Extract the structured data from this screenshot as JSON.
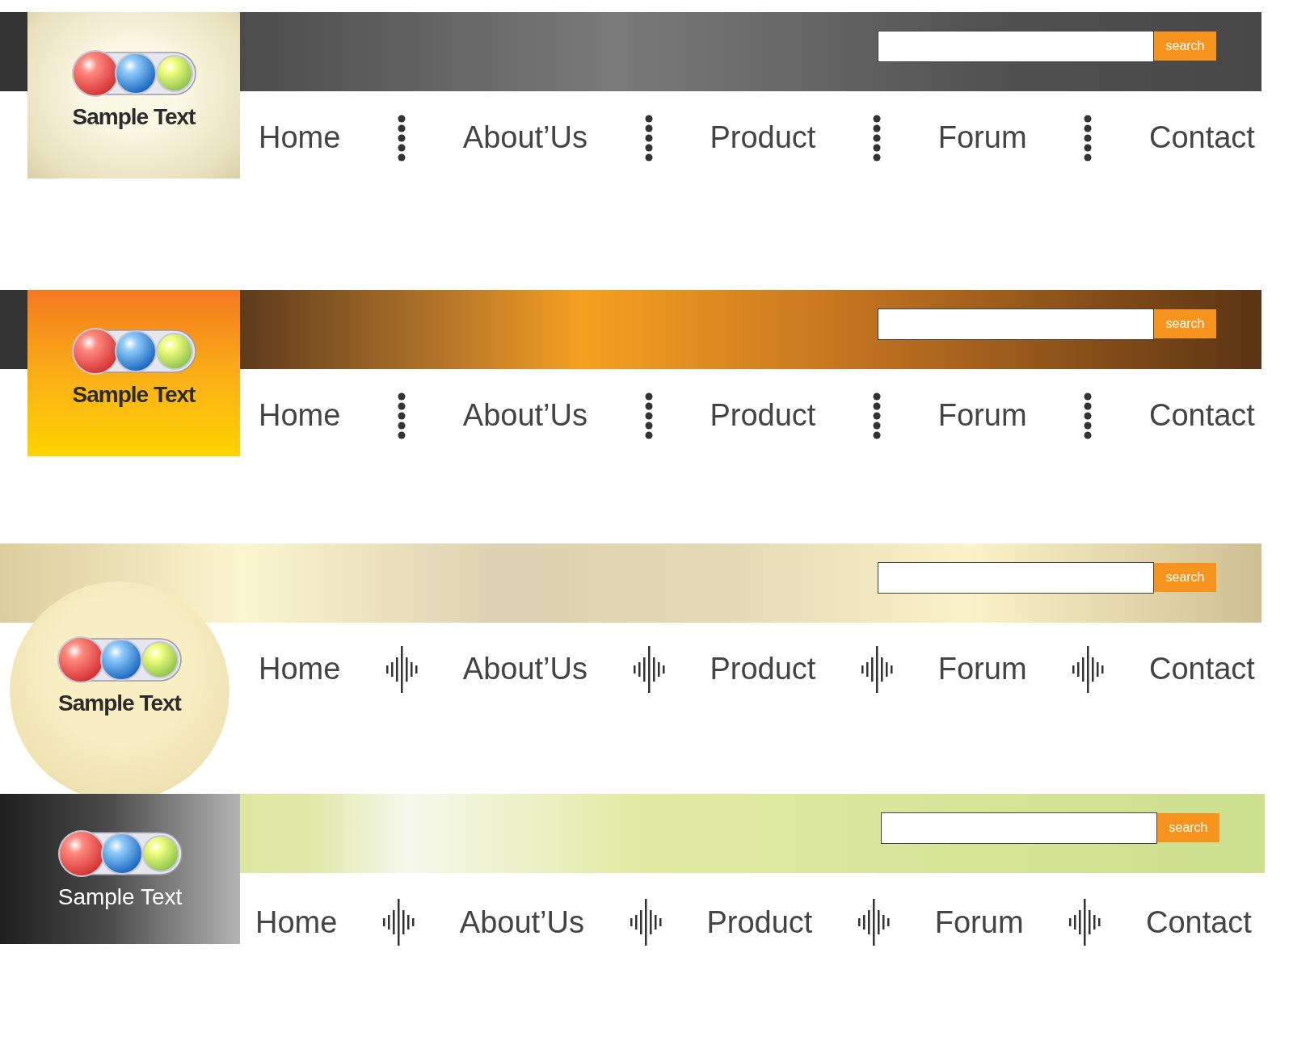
{
  "headers": [
    {
      "kind": "dark",
      "logo_text": "Sample Text",
      "search_button": "search",
      "separator": {
        "kind": "dots"
      },
      "nav": [
        "Home",
        "About’Us",
        "Product",
        "Forum",
        "Contact"
      ]
    },
    {
      "kind": "orange",
      "logo_text": "Sample Text",
      "search_button": "search",
      "separator": {
        "kind": "dots"
      },
      "nav": [
        "Home",
        "About’Us",
        "Product",
        "Forum",
        "Contact"
      ]
    },
    {
      "kind": "beige",
      "logo_text": "Sample Text",
      "search_button": "search",
      "separator": {
        "kind": "wave"
      },
      "nav": [
        "Home",
        "About’Us",
        "Product",
        "Forum",
        "Contact"
      ]
    },
    {
      "kind": "green",
      "logo_text": "Sample Text",
      "search_button": "search",
      "separator": {
        "kind": "wave"
      },
      "nav": [
        "Home",
        "About’Us",
        "Product",
        "Forum",
        "Contact"
      ]
    }
  ]
}
